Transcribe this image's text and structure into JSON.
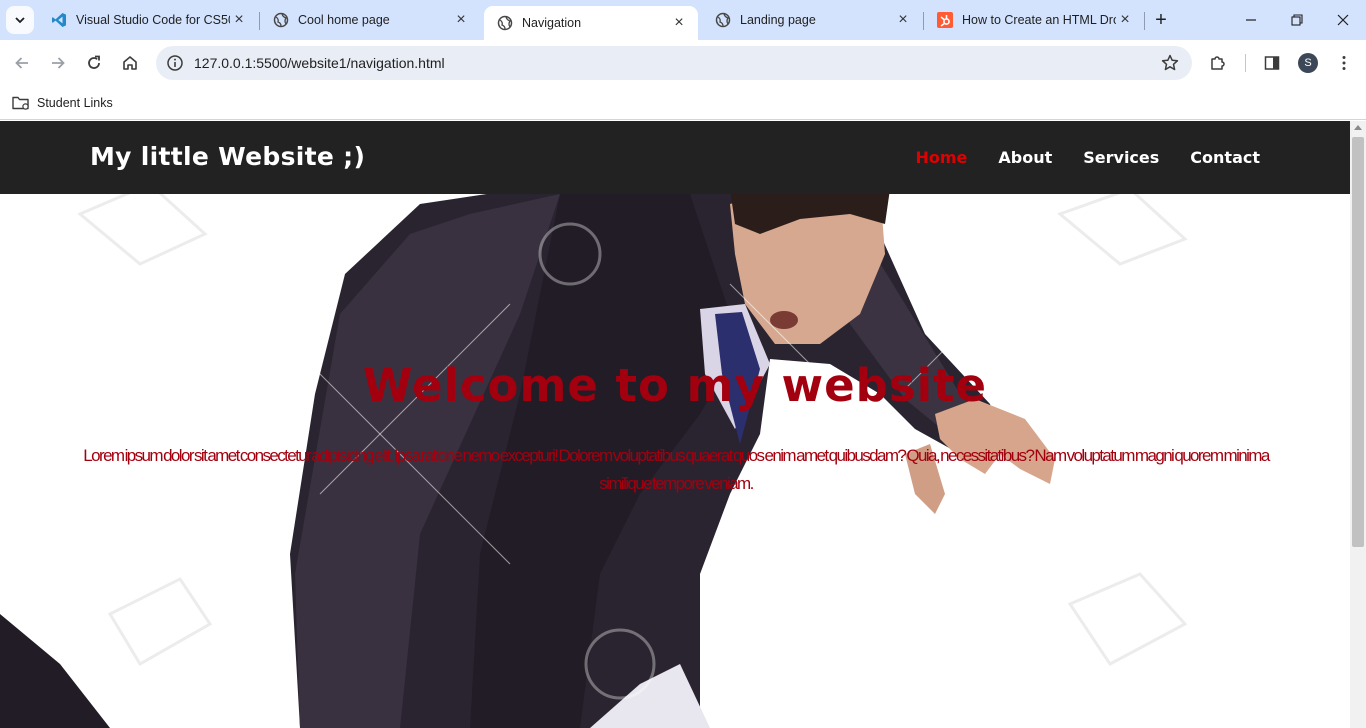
{
  "browser": {
    "tabs": [
      {
        "title": "Visual Studio Code for CS50",
        "icon": "vscode-icon",
        "active": false
      },
      {
        "title": "Cool home page",
        "icon": "globe-icon",
        "active": false
      },
      {
        "title": "Navigation",
        "icon": "globe-icon",
        "active": true
      },
      {
        "title": "Landing page",
        "icon": "globe-icon",
        "active": false
      },
      {
        "title": "How to Create an HTML Dro",
        "icon": "hubspot-icon",
        "active": false
      }
    ],
    "address": {
      "url": "127.0.0.1:5500/website1/navigation.html"
    },
    "bookmarks": [
      {
        "label": "Student Links",
        "icon": "folder-icon"
      }
    ],
    "profile_initial": "S",
    "accent_color": "#d3e3fd"
  },
  "site": {
    "logo": "My little Website ;)",
    "nav": {
      "home": "Home",
      "about": "About",
      "services": "Services",
      "contact": "Contact"
    },
    "nav_active": "Home",
    "nav_active_color": "#e00000",
    "hero": {
      "title": "Welcome to my website",
      "text": "Lorem ipsum dolor sit amet consectetur adipisicing elit. Ipsa ratione nemo excepturi! Dolorem voluptatibus quaerat quos enim amet quibusdam? Quia, necessitatibus? Nam voluptatum magni quorem minima similique tempore veniam.",
      "text_color": "#a3000f"
    }
  }
}
